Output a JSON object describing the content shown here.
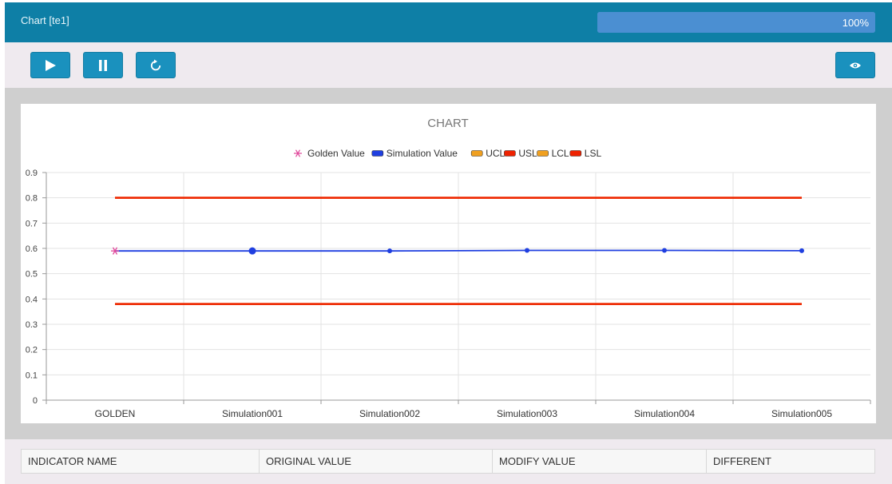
{
  "header": {
    "title": "Chart [te1]",
    "progress": {
      "value": 100,
      "label": "100%"
    }
  },
  "toolbar": {
    "buttons": [
      {
        "name": "play-button",
        "icon": "play-icon"
      },
      {
        "name": "pause-button",
        "icon": "pause-icon"
      },
      {
        "name": "reset-button",
        "icon": "refresh-icon"
      }
    ],
    "view_button": {
      "icon": "eye-icon"
    }
  },
  "colors": {
    "header_bg": "#0e7fa6",
    "button_bg": "#1a91be",
    "golden": "#e0469a",
    "simulation": "#1f3fe0",
    "ucl": "#f0a020",
    "usl": "#ee2200",
    "lcl": "#f0a020",
    "lsl": "#ee2200"
  },
  "chart_data": {
    "type": "line",
    "title": "CHART",
    "categories": [
      "GOLDEN",
      "Simulation001",
      "Simulation002",
      "Simulation003",
      "Simulation004",
      "Simulation005"
    ],
    "ylim": [
      0,
      0.9
    ],
    "yticks": [
      0,
      0.1,
      0.2,
      0.3,
      0.4,
      0.5,
      0.6,
      0.7,
      0.8,
      0.9
    ],
    "ytick_labels": [
      "0",
      "0.1",
      "0.2",
      "0.3",
      "0.4",
      "0.5",
      "0.6",
      "0.7",
      "0.8",
      "0.9"
    ],
    "grid": true,
    "legend_position": "top-center",
    "legend": [
      "Golden Value",
      "Simulation Value",
      "UCL",
      "USL",
      "LCL",
      "LSL"
    ],
    "series": [
      {
        "name": "Golden Value",
        "marker": "asterisk",
        "values": [
          0.59,
          null,
          null,
          null,
          null,
          null
        ]
      },
      {
        "name": "Simulation Value",
        "marker": "circle",
        "values": [
          0.59,
          0.59,
          0.59,
          0.592,
          0.592,
          0.591
        ]
      },
      {
        "name": "UCL",
        "values": [
          0.8,
          0.8,
          0.8,
          0.8,
          0.8,
          0.8
        ]
      },
      {
        "name": "USL",
        "values": [
          0.8,
          0.8,
          0.8,
          0.8,
          0.8,
          0.8
        ]
      },
      {
        "name": "LCL",
        "values": [
          0.38,
          0.38,
          0.38,
          0.38,
          0.38,
          0.38
        ]
      },
      {
        "name": "LSL",
        "values": [
          0.38,
          0.38,
          0.38,
          0.38,
          0.38,
          0.38
        ]
      }
    ]
  },
  "table": {
    "columns": [
      "INDICATOR NAME",
      "ORIGINAL VALUE",
      "MODIFY VALUE",
      "DIFFERENT"
    ]
  }
}
